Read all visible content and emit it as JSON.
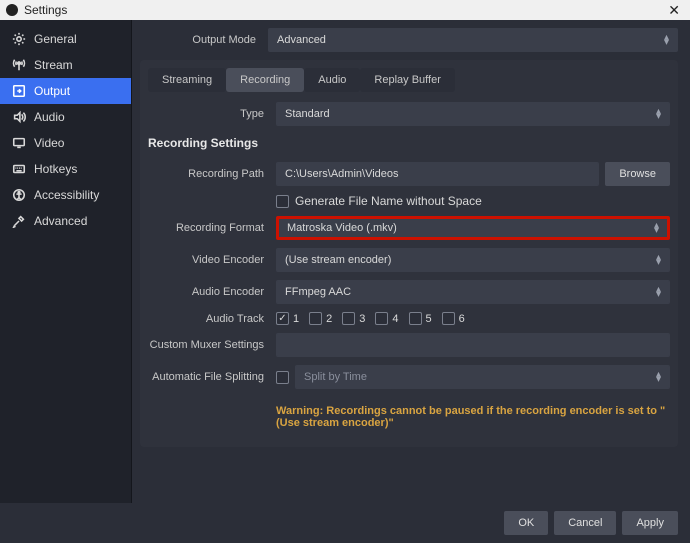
{
  "window": {
    "title": "Settings"
  },
  "sidebar": {
    "items": [
      {
        "label": "General"
      },
      {
        "label": "Stream"
      },
      {
        "label": "Output"
      },
      {
        "label": "Audio"
      },
      {
        "label": "Video"
      },
      {
        "label": "Hotkeys"
      },
      {
        "label": "Accessibility"
      },
      {
        "label": "Advanced"
      }
    ]
  },
  "output": {
    "output_mode_label": "Output Mode",
    "output_mode_value": "Advanced",
    "tabs": {
      "streaming": "Streaming",
      "recording": "Recording",
      "audio": "Audio",
      "replay_buffer": "Replay Buffer"
    },
    "type_label": "Type",
    "type_value": "Standard",
    "section_title": "Recording Settings",
    "recording_path_label": "Recording Path",
    "recording_path_value": "C:\\Users\\Admin\\Videos",
    "browse_label": "Browse",
    "gen_filename_label": "Generate File Name without Space",
    "recording_format_label": "Recording Format",
    "recording_format_value": "Matroska Video (.mkv)",
    "video_encoder_label": "Video Encoder",
    "video_encoder_value": "(Use stream encoder)",
    "audio_encoder_label": "Audio Encoder",
    "audio_encoder_value": "FFmpeg AAC",
    "audio_track_label": "Audio Track",
    "tracks": [
      "1",
      "2",
      "3",
      "4",
      "5",
      "6"
    ],
    "custom_muxer_label": "Custom Muxer Settings",
    "auto_split_label": "Automatic File Splitting",
    "split_by_value": "Split by Time",
    "warning_text": "Warning: Recordings cannot be paused if the recording encoder is set to \"(Use stream encoder)\""
  },
  "footer": {
    "ok": "OK",
    "cancel": "Cancel",
    "apply": "Apply"
  }
}
